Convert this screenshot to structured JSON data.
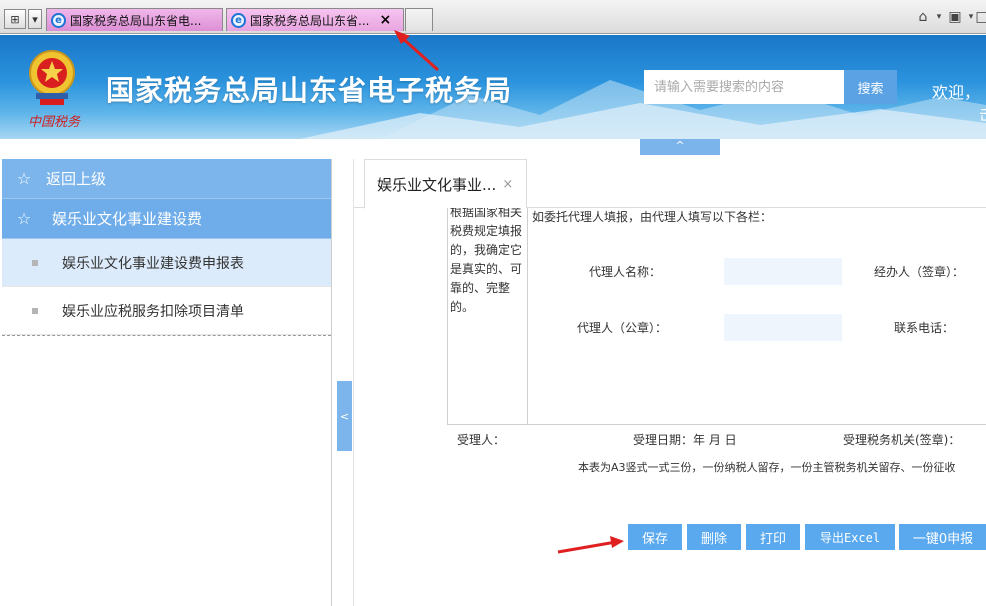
{
  "browser": {
    "tabs": [
      {
        "title": "国家税务总局山东省电..."
      },
      {
        "title": "国家税务总局山东省..."
      }
    ],
    "close_glyph": "×"
  },
  "header": {
    "emblem_caption": "中国税务",
    "site_title": "国家税务总局山东省电子税务局",
    "search_placeholder": "请输入需要搜索的内容",
    "search_button": "搜索",
    "welcome": "欢迎，",
    "welcome_line2": "击",
    "collapse_glyph": "^"
  },
  "sidebar": {
    "back_label": "返回上级",
    "section_label": "娱乐业文化事业建设费",
    "items": [
      {
        "label": "娱乐业文化事业建设费申报表",
        "selected": true
      },
      {
        "label": "娱乐业应税服务扣除项目清单",
        "selected": false
      }
    ],
    "toggle_glyph": "<"
  },
  "main": {
    "tab_label": "娱乐业文化事业...",
    "tab_close": "×",
    "declaration_text": "根据国家相关税费规定填报的，我确定它是真实的、可靠的、完整的。",
    "agent_note": "如委托代理人填报，由代理人填写以下各栏：",
    "fields": {
      "agent_name_label": "代理人名称：",
      "handler_label": "经办人（签章）：",
      "agent_seal_label": "代理人（公章）：",
      "phone_label": "联系电话："
    },
    "footer": {
      "receiver": "受理人：",
      "receive_date": "受理日期：年 月 日",
      "tax_office": "受理税务机关(签章)："
    },
    "footnote": "本表为A3竖式一式三份，一份纳税人留存，一份主管税务机关留存、一份征收",
    "buttons": {
      "save": "保存",
      "delete": "删除",
      "print": "打印",
      "export": "导出Excel",
      "zero_report": "一键0申报"
    }
  },
  "colors": {
    "accent": "#5aa9ee",
    "sidebar_head": "#7cb5ec",
    "annotation_arrow": "#e02020"
  }
}
